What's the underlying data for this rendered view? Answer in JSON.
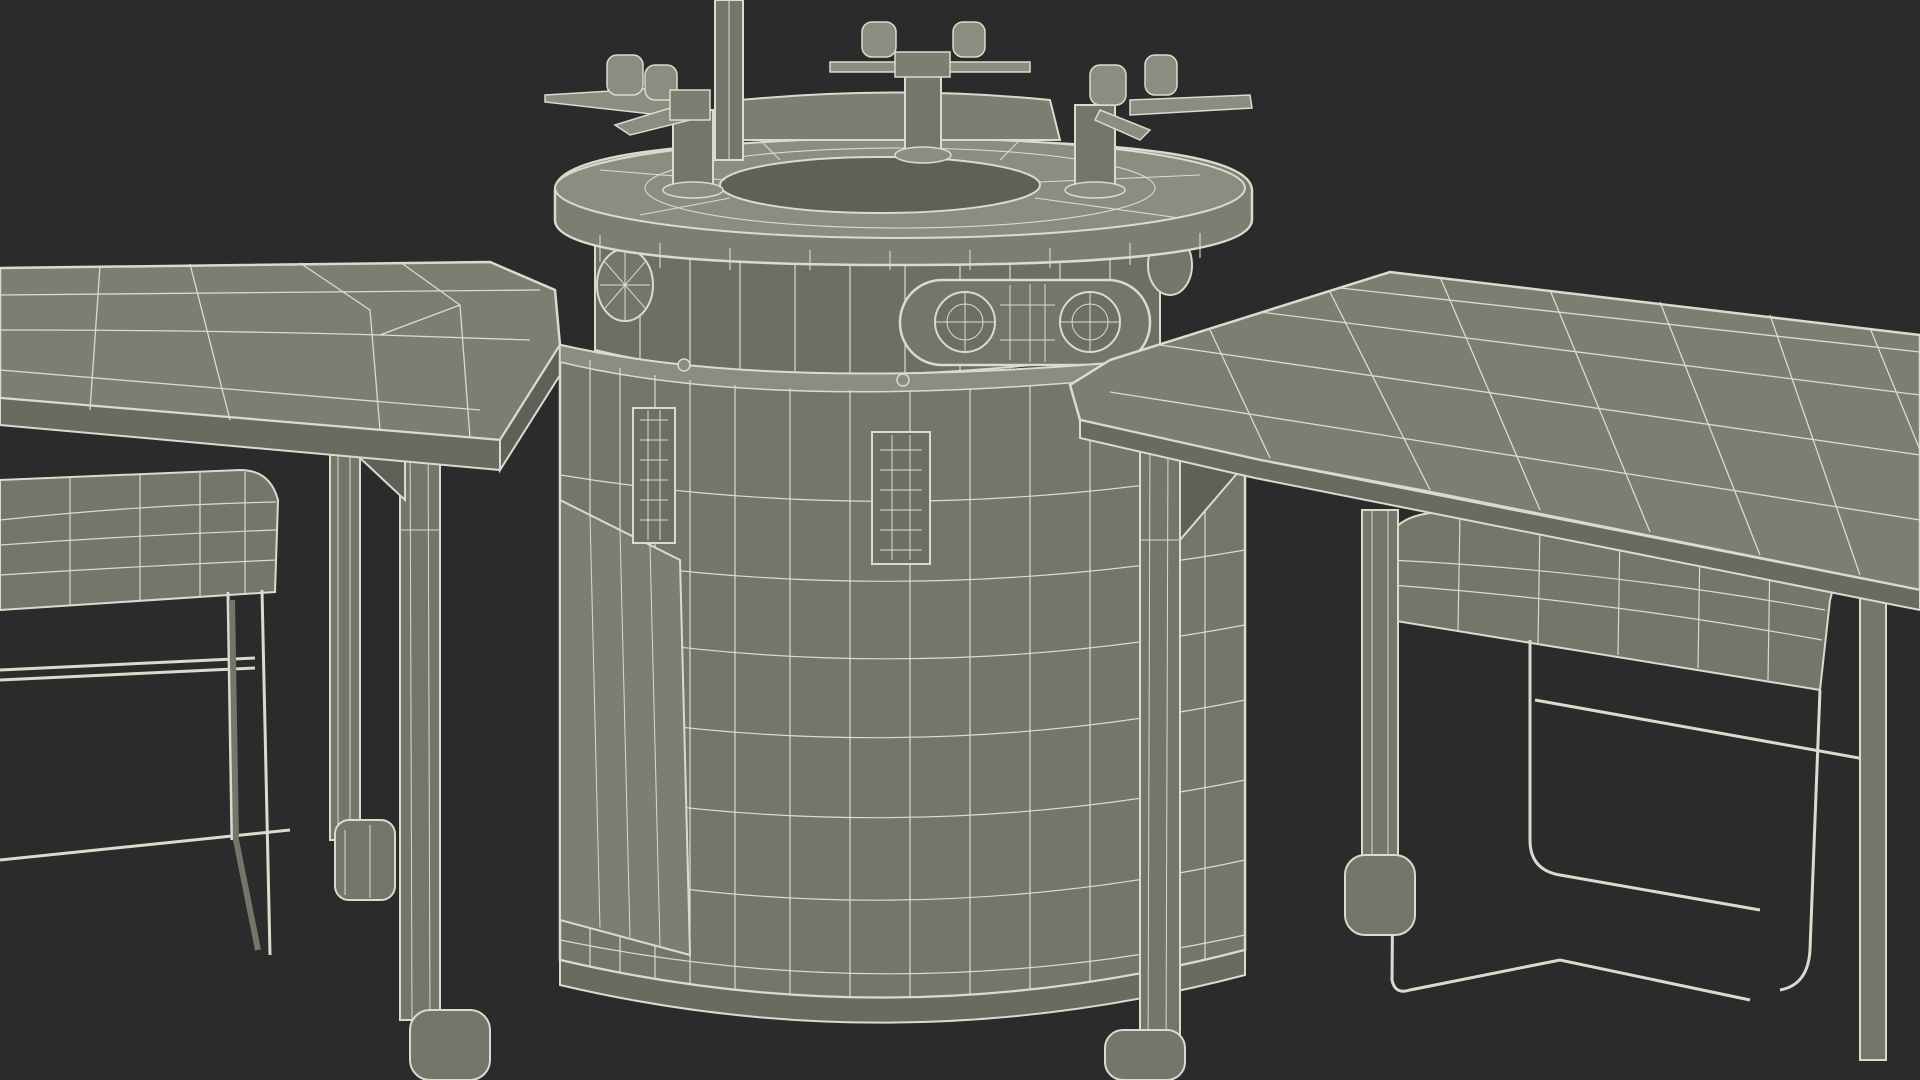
{
  "scene": {
    "type": "3d-wireframe-render",
    "colors": {
      "background": "#2a2c2c",
      "surface": "#73766a",
      "surface_light": "#8a8d80",
      "surface_dark": "#5e6157",
      "wire": "#d9dccd",
      "wire_dim": "#b8bba9"
    }
  }
}
